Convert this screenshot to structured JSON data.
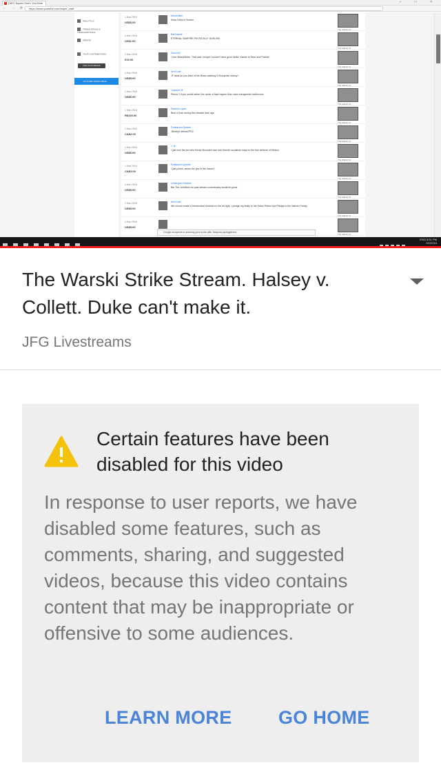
{
  "embedded_desktop": {
    "browser_tab_title": "(387) Super Chat • YouTube",
    "url": "https://www.youtube.com/super_chat",
    "sidebar": {
      "items": [
        "ANALYTICS",
        "TRANSLATIONS & TRANSCRIPTIONS",
        "CREATE",
        "YOUR CONTRIBUTIONS"
      ],
      "help_button": "Help and feedback",
      "active_item": "YOUTUBE STUDIO BETA"
    },
    "super_chats": [
      {
        "date": "1 Mar 2018",
        "amount": "US$5.00",
        "user": "NeonKitten",
        "message": "Keep Deep in Sodom"
      },
      {
        "date": "1 Mar 2018",
        "amount": "US$2.00",
        "user": "Bat Islamé",
        "message": "ETERNAL VAMPIRE PHYSICALLY DUELING"
      },
      {
        "date": "1 Mar 2018",
        "amount": "€10.00",
        "user": "Saxon42",
        "message": "I love Mike&Strike. That said, tonight I couldn't have gone better, thanks to Marc and Patrick!"
      },
      {
        "date": "1 Mar 2018",
        "amount": "US$5.00",
        "user": "ArmCode",
        "message": "JF what do you think of the Black washing of European history?"
      },
      {
        "date": "1 Mar 2018",
        "amount": "US$5.00",
        "user": "Joshone M",
        "message": "Pierce !! if you would rather live under a Nazi regime than have transgender bathrooms"
      },
      {
        "date": "1 Mar 2018",
        "amount": "R$100.00",
        "user": "Dawhid Lopes",
        "message": "Best of luck during this infowek dark age"
      },
      {
        "date": "1 Mar 2018",
        "amount": "CA$2.00",
        "user": "Fullstackin Quieter",
        "message": "JBobby4 #eliad2PD2"
      },
      {
        "date": "1 Mar 2018",
        "amount": "US$5.00",
        "user": "J. M.",
        "message": "I just love the jew who thinks Mussolini was anti-Semitic socialists reaps to the fine defense of Mexico"
      },
      {
        "date": "1 Mar 2018",
        "amount": "CA$2.00",
        "user": "Fullstackin Quieter",
        "message": "I just joined, where the jew in the dream?"
      },
      {
        "date": "1 Mar 2018",
        "amount": "US$5.00",
        "user": "Undergrpm Hadron",
        "message": "Btb The JohnBolo for post stream commentary would be great"
      },
      {
        "date": "1 Mar 2018",
        "amount": "US$5.00",
        "user": "ArmCode",
        "message": "We should create a hierarchical structure in the alt right. I pledge my fealty to the Swiss Patriot and Pledge to the Warren Family"
      },
      {
        "date": "1 Mar 2018",
        "amount": "US$5.00",
        "user": "",
        "message": ""
      }
    ],
    "thumb_caption": "The Warski St...",
    "chat_placeholder": "Google.recaptcha is alarming your to the with Tarapura apologeticed..",
    "chat_send": "SEND MESSAGE",
    "chat_tail": "a? Chat have loss discord pg",
    "taskbar_clock": {
      "lang": "ENG",
      "time": "8:51 PM",
      "date": "3/1/2018"
    },
    "progress_fraction": 1.0
  },
  "video": {
    "title": "The Warski Strike Stream. Halsey v. Collett. Duke can't make it.",
    "channel": "JFG Livestreams"
  },
  "notice": {
    "heading": "Certain features have been disabled for this video",
    "body": "In response to user reports, we have disabled some features, such as comments, sharing, and suggested videos, because this video contains content that may be inappropriate or offensive to some audiences.",
    "learn_more": "LEARN MORE",
    "go_home": "GO HOME"
  },
  "colors": {
    "accent_link": "#4a84d8",
    "warning_yellow": "#f4c20d",
    "notice_bg": "#eeeeee",
    "progress_red": "#ff1a1a"
  },
  "icons": [
    "warning-icon",
    "chevron-down-icon"
  ]
}
